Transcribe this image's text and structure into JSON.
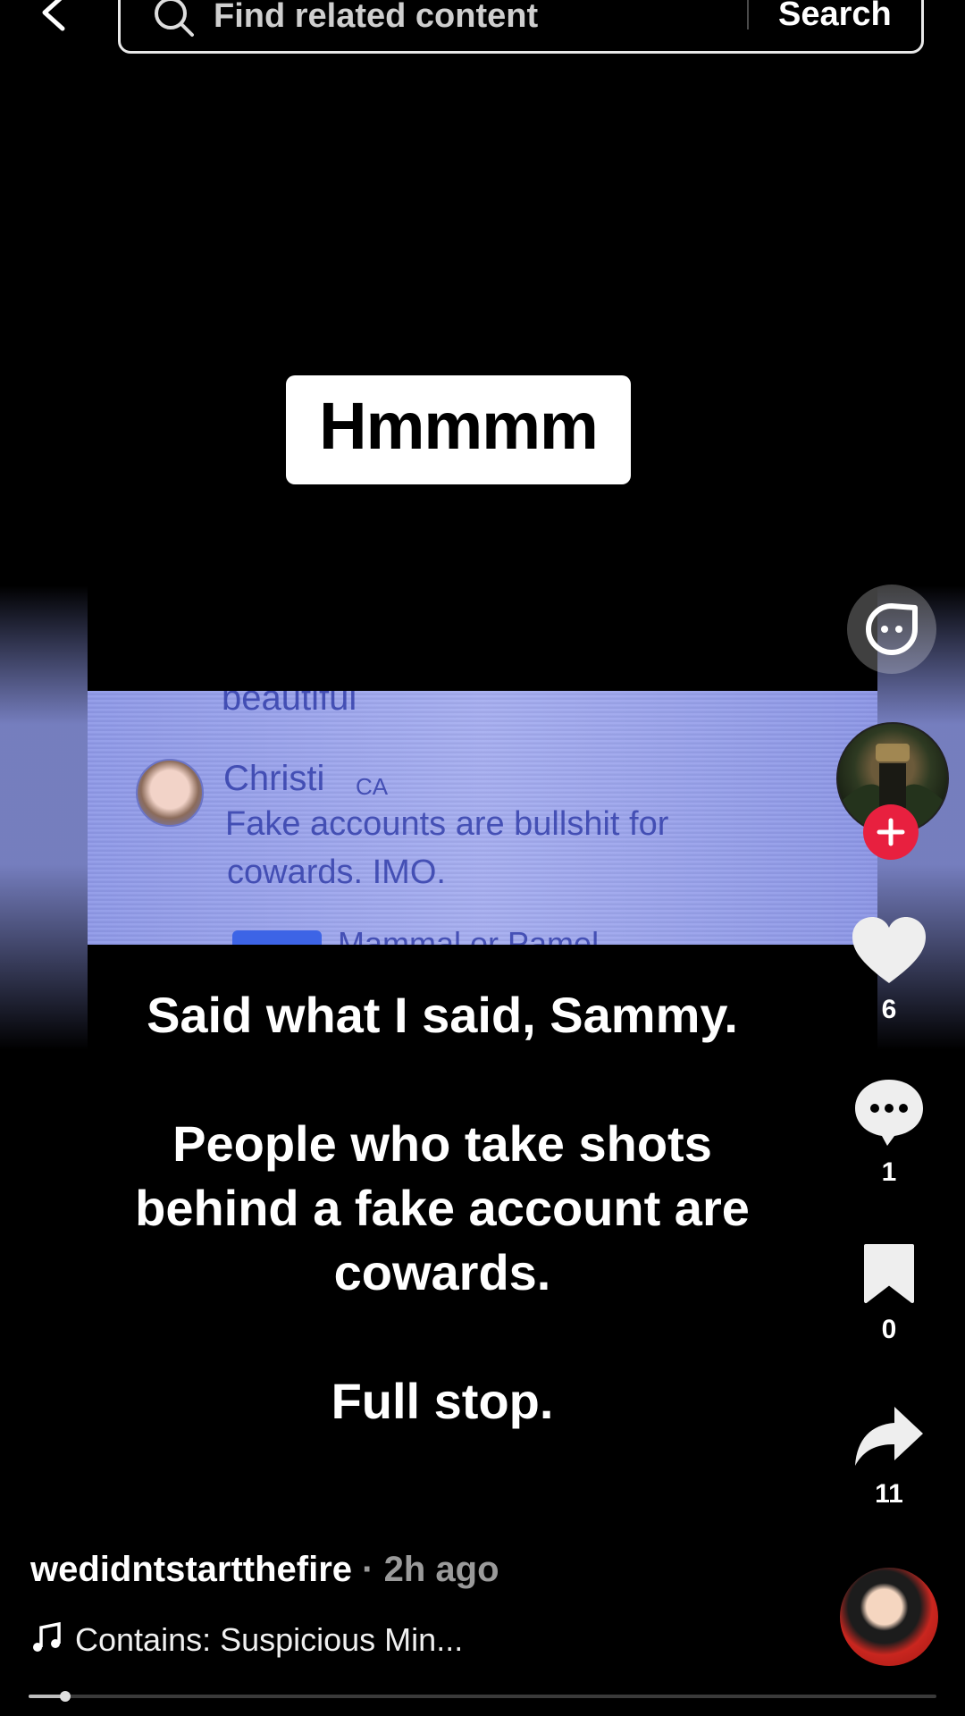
{
  "search": {
    "placeholder": "Find related content",
    "button_label": "Search"
  },
  "video": {
    "caption": "Hmmmm",
    "screenshot": {
      "partial_text_top": "beautiful",
      "commenter_name": "Christi",
      "commenter_tag": "CA",
      "comment_line_1": "Fake accounts are bullshit for",
      "comment_line_2": "cowards. IMO.",
      "partial_text_bottom": "Mammal or Pamel"
    },
    "overlay_lines": [
      "Said what I said, Sammy.",
      "",
      "People who take shots",
      "behind a fake account are",
      "cowards.",
      "",
      "Full stop."
    ]
  },
  "actions": {
    "likes": "6",
    "comments": "1",
    "saves": "0",
    "shares": "11"
  },
  "post": {
    "author": "wedidntstartthefire",
    "time": "· 2h ago",
    "music": "Contains: Suspicious Min..."
  },
  "progress": 0.04,
  "colors": {
    "background": "#000000",
    "follow_plus": "#e8203f",
    "screenshot_tint": "#a6aef0"
  },
  "icons": [
    "back-arrow-icon",
    "search-icon",
    "ai-assistant-icon",
    "heart-icon",
    "comment-icon",
    "bookmark-icon",
    "share-icon",
    "music-note-icon",
    "plus-icon"
  ]
}
